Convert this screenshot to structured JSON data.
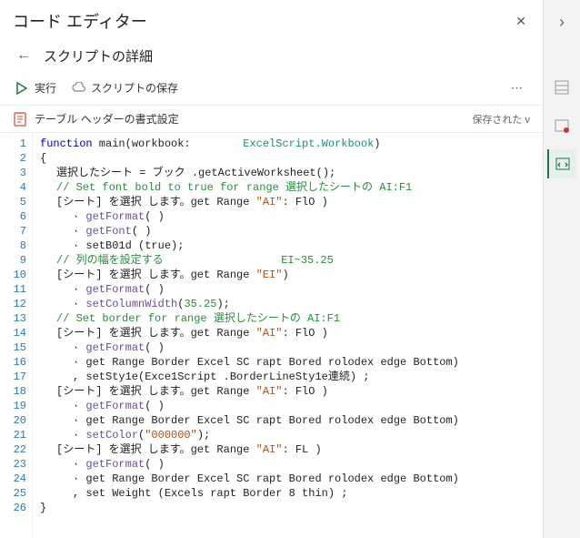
{
  "titlebar": {
    "title": "コード エディター"
  },
  "subtitle": {
    "label": "スクリプトの詳細"
  },
  "toolbar": {
    "run_label": "実行",
    "save_label": "スクリプトの保存",
    "more_label": "⋯"
  },
  "script": {
    "name": "テーブル ヘッダーの書式設定",
    "saved_label": "保存された v"
  },
  "icons": {
    "back": "←",
    "close": "✕",
    "chevron_right": "›",
    "dots": "⋯"
  },
  "code": {
    "lines": [
      {
        "n": 1,
        "frags": [
          {
            "t": "function",
            "c": "tok-kw"
          },
          {
            "t": " main(workbook:        ",
            "c": "tok-ident"
          },
          {
            "t": "ExcelScript.Workbook",
            "c": "tok-type"
          },
          {
            "t": ")",
            "c": "tok-ident"
          }
        ],
        "indent": 0
      },
      {
        "n": 2,
        "frags": [
          {
            "t": "{",
            "c": "tok-ident"
          }
        ],
        "indent": 0
      },
      {
        "n": 3,
        "frags": [
          {
            "t": "選択したシート = ブック ",
            "c": "tok-ident"
          },
          {
            "t": ".getActiveWorksheet();",
            "c": "tok-ident"
          }
        ],
        "indent": 1
      },
      {
        "n": 4,
        "frags": [
          {
            "t": "// Set font bold to true for range",
            "c": "tok-cmt"
          },
          {
            "t": " 選択したシートの AI:F1",
            "c": "tok-cmt2"
          }
        ],
        "indent": 1
      },
      {
        "n": 5,
        "frags": [
          {
            "t": "[シート] を選択 します。get Range ",
            "c": "tok-ident"
          },
          {
            "t": "\"AI\"",
            "c": "tok-str"
          },
          {
            "t": ": FlO )",
            "c": "tok-ident"
          }
        ],
        "indent": 1
      },
      {
        "n": 6,
        "frags": [
          {
            "t": "· ",
            "c": "tok-ident"
          },
          {
            "t": "getFormat",
            "c": "tok-func"
          },
          {
            "t": "( )",
            "c": "tok-ident"
          }
        ],
        "indent": 2
      },
      {
        "n": 7,
        "frags": [
          {
            "t": "· ",
            "c": "tok-ident"
          },
          {
            "t": "getFont",
            "c": "tok-func"
          },
          {
            "t": "( )",
            "c": "tok-ident"
          }
        ],
        "indent": 2
      },
      {
        "n": 8,
        "frags": [
          {
            "t": "· setB01d (true);",
            "c": "tok-ident"
          }
        ],
        "indent": 2
      },
      {
        "n": 9,
        "frags": [
          {
            "t": "// 列の幅を設定する                  EI~35.25",
            "c": "tok-cmt"
          }
        ],
        "indent": 1
      },
      {
        "n": 10,
        "frags": [
          {
            "t": "[シート] を選択 します。get Range ",
            "c": "tok-ident"
          },
          {
            "t": "\"EI\"",
            "c": "tok-str"
          },
          {
            "t": ")",
            "c": "tok-ident"
          }
        ],
        "indent": 1
      },
      {
        "n": 11,
        "frags": [
          {
            "t": "· ",
            "c": "tok-ident"
          },
          {
            "t": "getFormat",
            "c": "tok-func"
          },
          {
            "t": "( )",
            "c": "tok-ident"
          }
        ],
        "indent": 2
      },
      {
        "n": 12,
        "frags": [
          {
            "t": "· ",
            "c": "tok-ident"
          },
          {
            "t": "setColumnWidth",
            "c": "tok-func"
          },
          {
            "t": "(",
            "c": "tok-ident"
          },
          {
            "t": "35.25",
            "c": "tok-num"
          },
          {
            "t": ");",
            "c": "tok-ident"
          }
        ],
        "indent": 2
      },
      {
        "n": 13,
        "frags": [
          {
            "t": "// Set border for range",
            "c": "tok-cmt"
          },
          {
            "t": " 選択したシートの AI:F1",
            "c": "tok-cmt2"
          }
        ],
        "indent": 1
      },
      {
        "n": 14,
        "frags": [
          {
            "t": "[シート] を選択 します。get Range ",
            "c": "tok-ident"
          },
          {
            "t": "\"AI\"",
            "c": "tok-str"
          },
          {
            "t": ": FlO )",
            "c": "tok-ident"
          }
        ],
        "indent": 1
      },
      {
        "n": 15,
        "frags": [
          {
            "t": "· ",
            "c": "tok-ident"
          },
          {
            "t": "getFormat",
            "c": "tok-func"
          },
          {
            "t": "( )",
            "c": "tok-ident"
          }
        ],
        "indent": 2
      },
      {
        "n": 16,
        "frags": [
          {
            "t": "· get Range Border Excel SC rapt Bored rolodex edge Bottom)",
            "c": "tok-ident"
          }
        ],
        "indent": 2
      },
      {
        "n": 17,
        "frags": [
          {
            "t": ", setSty1e(Exce1Script .BorderLineSty1e連続) ;",
            "c": "tok-ident"
          }
        ],
        "indent": 2
      },
      {
        "n": 18,
        "frags": [
          {
            "t": "[シート] を選択 します。get Range ",
            "c": "tok-ident"
          },
          {
            "t": "\"AI\"",
            "c": "tok-str"
          },
          {
            "t": ": FlO )",
            "c": "tok-ident"
          }
        ],
        "indent": 1
      },
      {
        "n": 19,
        "frags": [
          {
            "t": "· ",
            "c": "tok-ident"
          },
          {
            "t": "getFormat",
            "c": "tok-func"
          },
          {
            "t": "( )",
            "c": "tok-ident"
          }
        ],
        "indent": 2
      },
      {
        "n": 20,
        "frags": [
          {
            "t": "· get Range Border Excel SC rapt Bored rolodex edge Bottom)",
            "c": "tok-ident"
          }
        ],
        "indent": 2
      },
      {
        "n": 21,
        "frags": [
          {
            "t": "· ",
            "c": "tok-ident"
          },
          {
            "t": "setColor",
            "c": "tok-func"
          },
          {
            "t": "(",
            "c": "tok-ident"
          },
          {
            "t": "\"000000\"",
            "c": "tok-str"
          },
          {
            "t": ");",
            "c": "tok-ident"
          }
        ],
        "indent": 2
      },
      {
        "n": 22,
        "frags": [
          {
            "t": "[シート] を選択 します。get Range ",
            "c": "tok-ident"
          },
          {
            "t": "\"AI\"",
            "c": "tok-str"
          },
          {
            "t": ": FL )",
            "c": "tok-ident"
          }
        ],
        "indent": 1
      },
      {
        "n": 23,
        "frags": [
          {
            "t": "· ",
            "c": "tok-ident"
          },
          {
            "t": "getFormat",
            "c": "tok-func"
          },
          {
            "t": "( )",
            "c": "tok-ident"
          }
        ],
        "indent": 2
      },
      {
        "n": 24,
        "frags": [
          {
            "t": "· get Range Border Excel SC rapt Bored rolodex edge Bottom)",
            "c": "tok-ident"
          }
        ],
        "indent": 2
      },
      {
        "n": 25,
        "frags": [
          {
            "t": ", set Weight (Excels rapt Border 8 thin) ;",
            "c": "tok-ident"
          }
        ],
        "indent": 2
      },
      {
        "n": 26,
        "frags": [
          {
            "t": "}",
            "c": "tok-ident"
          }
        ],
        "indent": 0
      }
    ]
  }
}
